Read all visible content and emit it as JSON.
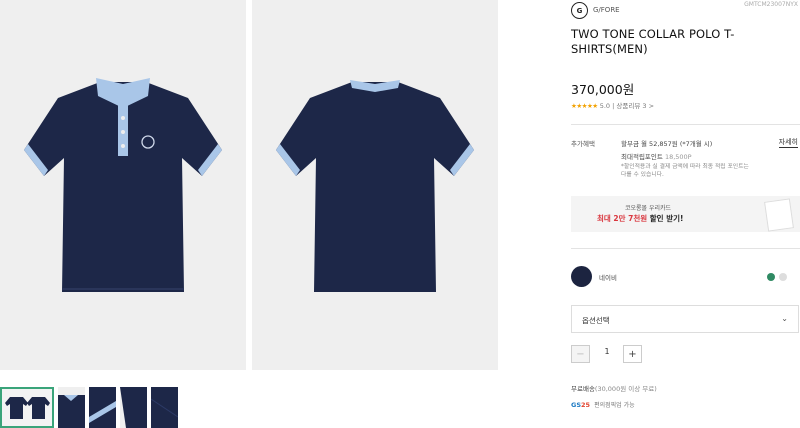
{
  "brand": {
    "logo_text": "G",
    "name": "G/FORE",
    "sku": "GMTCM23007NYX"
  },
  "product": {
    "title": "TWO TONE COLLAR POLO T-SHIRTS(MEN)",
    "price": "370,000원",
    "stars": "★★★★★",
    "rating_score": "5.0",
    "rating_separator": " | ",
    "review_link": "상품리뷰 3 >"
  },
  "benefits": {
    "label": "추가혜택",
    "installment": "할부금 월 52,857원 (*7개월 시)",
    "detail_link": "자세히",
    "points_label": "최대적립포인트",
    "points_value": " 18,500P",
    "note": "*할인적용과 실 결제 금액에 따라 최종 적립 포인트는 다를 수 있습니다."
  },
  "card_banner": {
    "line1": "코오롱몰 우리카드",
    "highlight": "최대 2만 7천원",
    "line2_suffix": " 할인 받기!"
  },
  "color": {
    "name": "네이비",
    "selected_color": "#1c2440",
    "alt_colors": [
      "#2f8a63",
      "#dddddd"
    ]
  },
  "option": {
    "label": "옵션선택",
    "chevron": "⌄"
  },
  "quantity": {
    "minus": "−",
    "value": "1",
    "plus": "+"
  },
  "shipping": {
    "label": "무료배송",
    "condition": "(30,000원 이상 무료)"
  },
  "pickup": {
    "logo_gs": "GS",
    "logo_num": "25",
    "text": "편의점픽업 가능"
  },
  "gallery": {
    "shirt_color": "#1d2748",
    "collar_color": "#a9c6e8",
    "background": "#efefef"
  }
}
